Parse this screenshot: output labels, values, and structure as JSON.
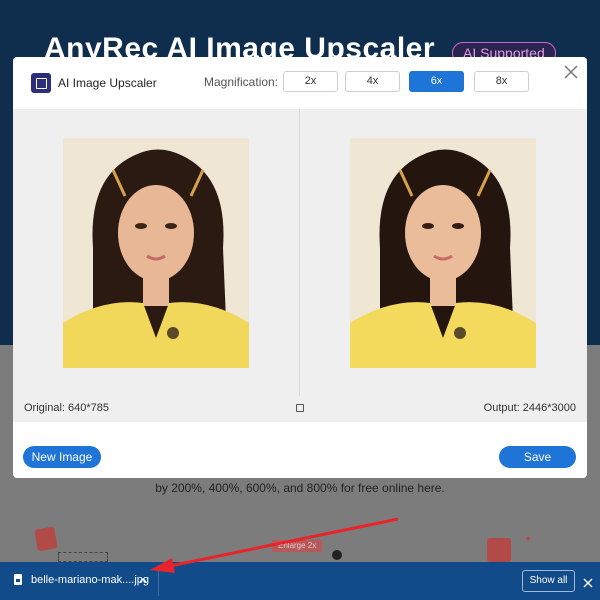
{
  "background": {
    "title": "AnyRec AI Image Upscaler",
    "badge": "AI Supported",
    "subtitle": "by 200%, 400%, 600%, and 800% for free online here.",
    "illustration_label": "Enlarge 2x"
  },
  "dialog": {
    "app_title": "AI Image Upscaler",
    "magnification_label": "Magnification:",
    "magnification_options": [
      "2x",
      "4x",
      "6x",
      "8x"
    ],
    "selected_magnification": "6x",
    "original_info": "Original: 640*785",
    "output_info": "Output: 2446*3000",
    "new_image_label": "New Image",
    "save_label": "Save"
  },
  "download_bar": {
    "filename": "belle-mariano-mak....jpg",
    "show_all_label": "Show all"
  },
  "colors": {
    "accent": "#1f74d8",
    "page_header": "#0f2e4d",
    "download_bar": "#124b8a",
    "annotation": "#e8242a"
  },
  "icons": {
    "app_logo": "image-upscale-icon",
    "close": "close-icon",
    "compare": "compare-icon",
    "file": "file-icon",
    "chevron": "chevron-up-icon",
    "download_close": "close-icon"
  }
}
